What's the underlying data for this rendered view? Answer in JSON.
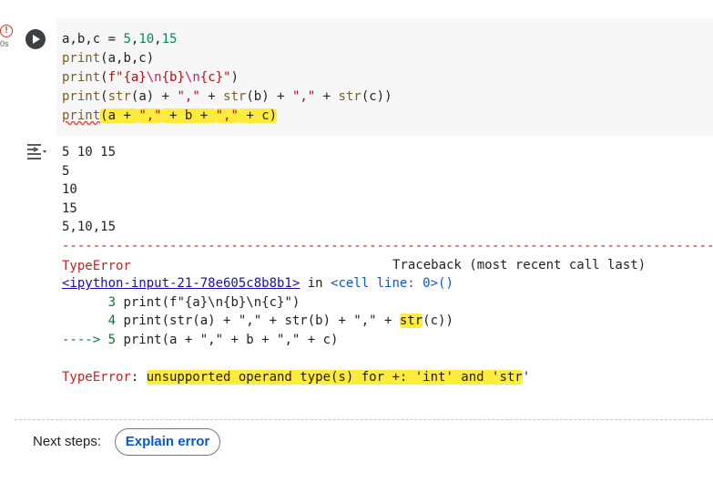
{
  "cell": {
    "error_badge": "!",
    "exec_time": "0s",
    "code_lines": [
      [
        {
          "t": "a,b,c = ",
          "c": "id"
        },
        {
          "t": "5",
          "c": "num"
        },
        {
          "t": ",",
          "c": "id"
        },
        {
          "t": "10",
          "c": "num"
        },
        {
          "t": ",",
          "c": "id"
        },
        {
          "t": "15",
          "c": "num"
        }
      ],
      [
        {
          "t": "print",
          "c": "fn"
        },
        {
          "t": "(a,b,c)",
          "c": "id"
        }
      ],
      [
        {
          "t": "print",
          "c": "fn"
        },
        {
          "t": "(",
          "c": "id"
        },
        {
          "t": "f\"{a}",
          "c": "str"
        },
        {
          "t": "\\n",
          "c": "esc"
        },
        {
          "t": "{b}",
          "c": "str"
        },
        {
          "t": "\\n",
          "c": "esc"
        },
        {
          "t": "{c}\"",
          "c": "str"
        },
        {
          "t": ")",
          "c": "id"
        }
      ],
      [
        {
          "t": "print",
          "c": "fn"
        },
        {
          "t": "(",
          "c": "id"
        },
        {
          "t": "str",
          "c": "fn"
        },
        {
          "t": "(a) + ",
          "c": "id"
        },
        {
          "t": "\",\"",
          "c": "str"
        },
        {
          "t": " + ",
          "c": "id"
        },
        {
          "t": "str",
          "c": "fn"
        },
        {
          "t": "(b) + ",
          "c": "id"
        },
        {
          "t": "\",\"",
          "c": "str"
        },
        {
          "t": " + ",
          "c": "id"
        },
        {
          "t": "str",
          "c": "fn"
        },
        {
          "t": "(c))",
          "c": "id"
        }
      ],
      [
        {
          "t": "print",
          "c": "err-fn"
        },
        {
          "t": "(a + ",
          "c": "id",
          "hl": true
        },
        {
          "t": "\",\"",
          "c": "str",
          "hl": true
        },
        {
          "t": " + b + ",
          "c": "id",
          "hl": true
        },
        {
          "t": "\",\"",
          "c": "str",
          "hl": true
        },
        {
          "t": " + c)",
          "c": "id",
          "hl": true
        }
      ]
    ]
  },
  "output": {
    "icon": "output-toggle-icon",
    "stdout": [
      "5 10 15",
      "5",
      "10",
      "15",
      "5,10,15"
    ],
    "traceback": {
      "divider": "---------------------------------------------------------------------------------------------------",
      "error_type": "TypeError",
      "header_right": "Traceback (most recent call last)",
      "source_link": "<ipython-input-21-78e605c8b8b1>",
      "in_text": " in ",
      "cell_line": "<cell line: 0>",
      "cell_line_suffix": "()",
      "line3_num": "      3 ",
      "line3_code": "print(f\"{a}\\n{b}\\n{c}\")",
      "line4_num": "      4 ",
      "line4_code_a": "print(str(a) + \",\" + str(b) + \",\" + ",
      "line4_code_hl": "str",
      "line4_code_b": "(c))",
      "arrow": "----> 5 ",
      "line5_code": "print(a + \",\" + b + \",\" + c)",
      "final_type": "TypeError",
      "final_colon": ": ",
      "final_msg": "unsupported operand type(s) for +: 'int' and 'str",
      "final_msg_tail": "'"
    }
  },
  "next_steps": {
    "label": "Next steps:",
    "button": "Explain error"
  },
  "colors": {
    "highlight": "#ffeb3b",
    "error_red": "#c5221f",
    "button_blue": "#0b57d0"
  }
}
